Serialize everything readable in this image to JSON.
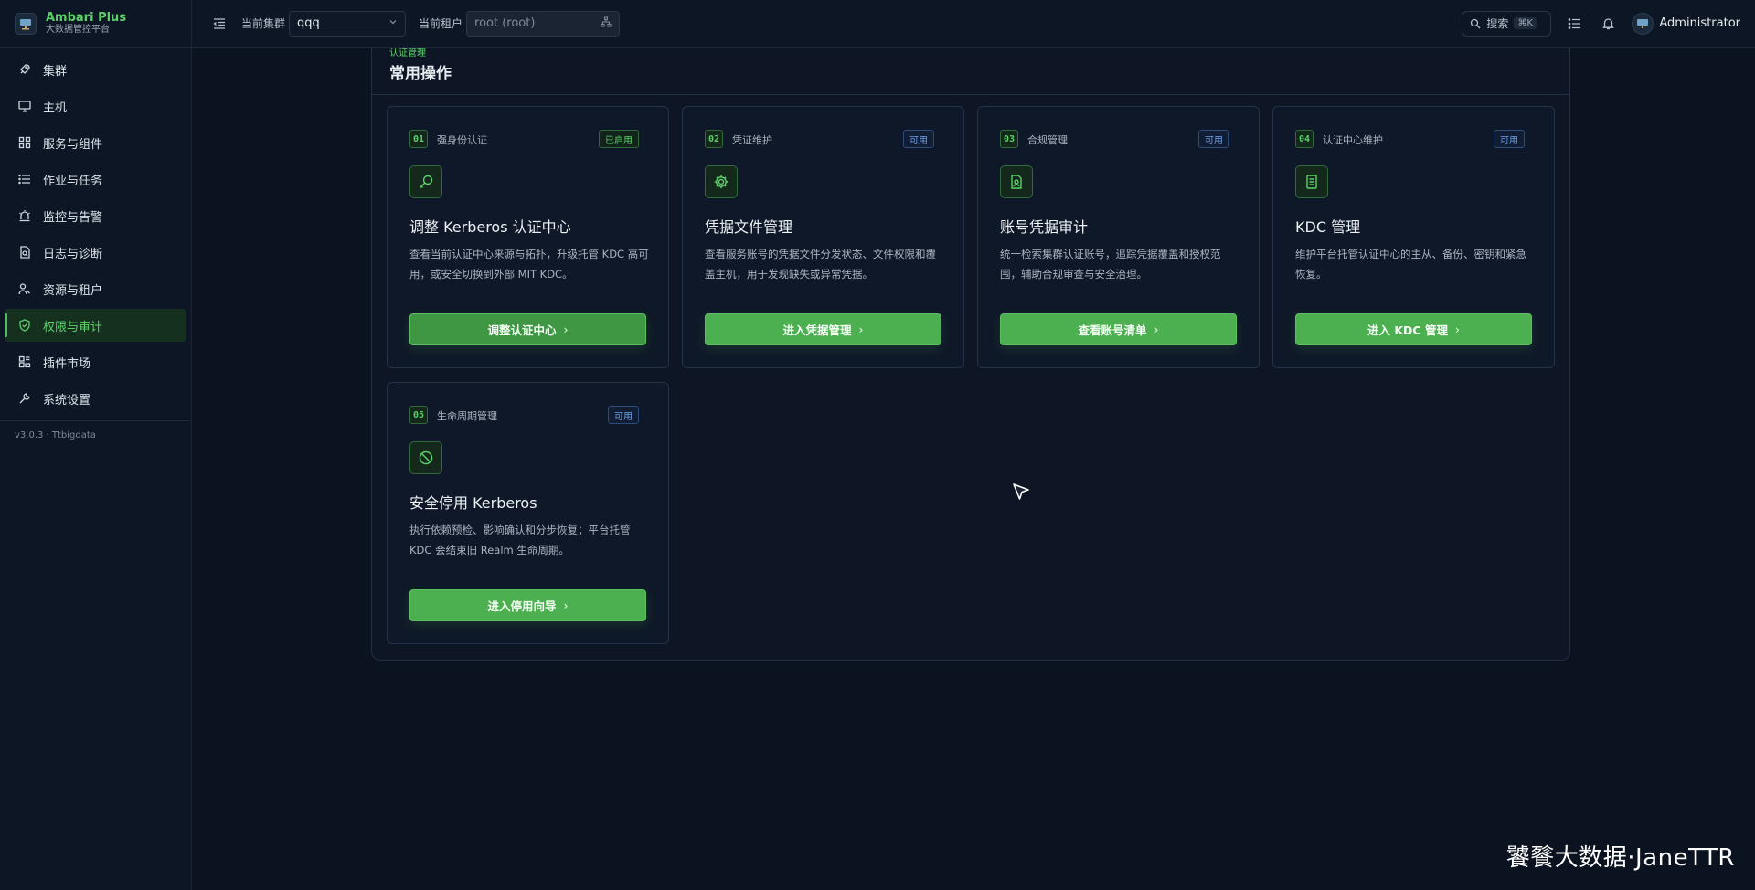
{
  "brand": {
    "title": "Ambari Plus",
    "subtitle": "大数据管控平台"
  },
  "sidebar": {
    "items": [
      {
        "label": "集群",
        "icon": "rocket-icon"
      },
      {
        "label": "主机",
        "icon": "monitor-icon"
      },
      {
        "label": "服务与组件",
        "icon": "grid-icon"
      },
      {
        "label": "作业与任务",
        "icon": "list-icon"
      },
      {
        "label": "监控与告警",
        "icon": "alarm-icon"
      },
      {
        "label": "日志与诊断",
        "icon": "log-icon"
      },
      {
        "label": "资源与租户",
        "icon": "users-icon"
      },
      {
        "label": "权限与审计",
        "icon": "shield-icon",
        "active": true
      },
      {
        "label": "插件市场",
        "icon": "plugin-icon"
      },
      {
        "label": "系统设置",
        "icon": "wrench-icon"
      }
    ],
    "version": "v3.0.3 · Ttbigdata"
  },
  "header": {
    "cluster_label": "当前集群",
    "cluster_value": "qqq",
    "tenant_label": "当前租户",
    "tenant_placeholder": "root (root)",
    "search_label": "搜索",
    "search_kbd": "⌘K",
    "user_name": "Administrator"
  },
  "main": {
    "eyebrow": "认证管理",
    "title": "常用操作",
    "cards": [
      {
        "num": "01",
        "kicker": "强身份认证",
        "badge": "已启用",
        "badge_type": "enabled",
        "icon": "search-key-icon",
        "title": "调整 Kerberos 认证中心",
        "desc": "查看当前认证中心来源与拓扑，升级托管 KDC 高可用，或安全切换到外部 MIT KDC。",
        "button": "调整认证中心"
      },
      {
        "num": "02",
        "kicker": "凭证维护",
        "badge": "可用",
        "badge_type": "available",
        "icon": "gear-icon",
        "title": "凭据文件管理",
        "desc": "查看服务账号的凭据文件分发状态、文件权限和覆盖主机，用于发现缺失或异常凭据。",
        "button": "进入凭据管理"
      },
      {
        "num": "03",
        "kicker": "合规管理",
        "badge": "可用",
        "badge_type": "available",
        "icon": "audit-file-icon",
        "title": "账号凭据审计",
        "desc": "统一检索集群认证账号，追踪凭据覆盖和授权范围，辅助合规审查与安全治理。",
        "button": "查看账号清单"
      },
      {
        "num": "04",
        "kicker": "认证中心维护",
        "badge": "可用",
        "badge_type": "available",
        "icon": "server-icon",
        "title": "KDC 管理",
        "desc": "维护平台托管认证中心的主从、备份、密钥和紧急恢复。",
        "button": "进入 KDC 管理"
      },
      {
        "num": "05",
        "kicker": "生命周期管理",
        "badge": "可用",
        "badge_type": "available",
        "icon": "ban-icon",
        "title": "安全停用 Kerberos",
        "desc": "执行依赖预检、影响确认和分步恢复；平台托管 KDC 会结束旧 Realm 生命周期。",
        "button": "进入停用向导"
      }
    ]
  },
  "watermark": "饕餮大数据·JaneTTR",
  "colors": {
    "accent": "#4caf50",
    "accent_text": "#5bd06a",
    "available": "#6f9ee8",
    "background": "#0b1320"
  }
}
